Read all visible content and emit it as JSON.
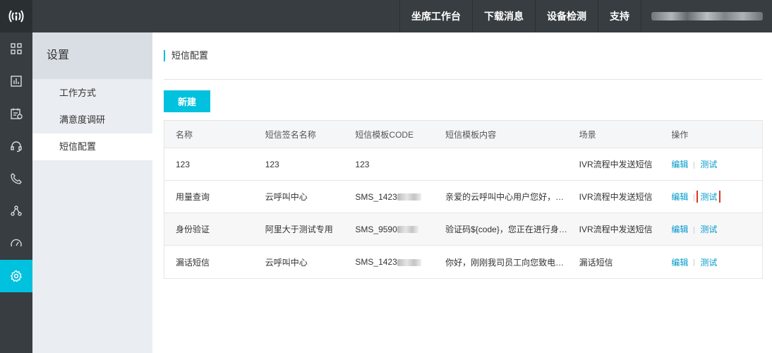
{
  "topbar": {
    "nav": [
      "坐席工作台",
      "下载消息",
      "设备检测",
      "支持"
    ]
  },
  "leftnav": {
    "icons": [
      "grid-icon",
      "bar-chart-icon",
      "calendar-list-icon",
      "headset-icon",
      "phone-icon",
      "share-nodes-icon",
      "speedometer-icon",
      "settings-icon"
    ],
    "active": "settings-icon"
  },
  "subnav": {
    "title": "设置",
    "items": [
      "工作方式",
      "满意度调研",
      "短信配置"
    ],
    "active": "短信配置"
  },
  "main": {
    "title": "短信配置",
    "new_button": "新建",
    "table": {
      "headers": [
        "名称",
        "短信签名名称",
        "短信模板CODE",
        "短信模板内容",
        "场景",
        "操作"
      ],
      "rows": [
        {
          "name": "123",
          "sign": "123",
          "code": "123",
          "content": "",
          "scene": "IVR流程中发送短信",
          "edit": "编辑",
          "test": "测试"
        },
        {
          "name": "用量查询",
          "sign": "云呼叫中心",
          "code": "SMS_1423",
          "content": "亲爱的云呼叫中心用户您好，您...",
          "scene": "IVR流程中发送短信",
          "edit": "编辑",
          "test": "测试"
        },
        {
          "name": "身份验证",
          "sign": "阿里大于测试专用",
          "code": "SMS_9590",
          "content": "验证码${code}，您正在进行身份...",
          "scene": "IVR流程中发送短信",
          "edit": "编辑",
          "test": "测试"
        },
        {
          "name": "漏话短信",
          "sign": "云呼叫中心",
          "code": "SMS_1423",
          "content": "你好，刚刚我司员工向您致电，...",
          "scene": "漏话短信",
          "edit": "编辑",
          "test": "测试"
        }
      ]
    }
  },
  "colors": {
    "accent": "#00c1de",
    "link": "#0099cc",
    "highlight": "#e0341f",
    "dark": "#373d41"
  }
}
